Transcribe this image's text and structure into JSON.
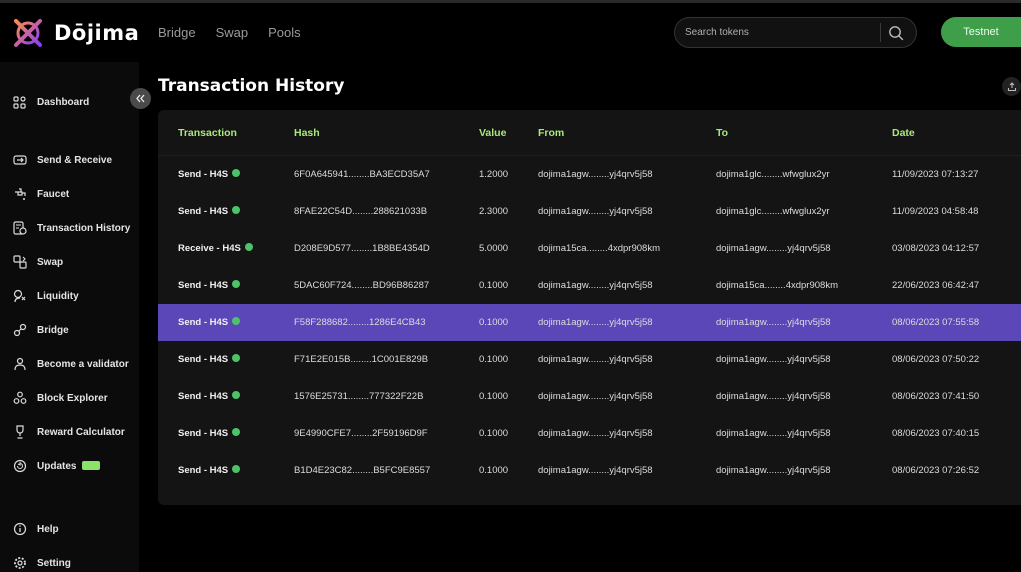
{
  "brand": {
    "name": "Dōjima"
  },
  "topnav": [
    {
      "label": "Bridge"
    },
    {
      "label": "Swap"
    },
    {
      "label": "Pools"
    }
  ],
  "search": {
    "placeholder": "Search tokens"
  },
  "network_button": {
    "label": "Testnet",
    "color": "#3f9e4a"
  },
  "sidebar": {
    "items": [
      {
        "label": "Dashboard",
        "icon": "dashboard-icon"
      },
      {
        "label": "Send & Receive",
        "icon": "send-receive-icon"
      },
      {
        "label": "Faucet",
        "icon": "faucet-icon"
      },
      {
        "label": "Transaction History",
        "icon": "history-icon"
      },
      {
        "label": "Swap",
        "icon": "swap-icon"
      },
      {
        "label": "Liquidity",
        "icon": "liquidity-icon"
      },
      {
        "label": "Bridge",
        "icon": "bridge-icon"
      },
      {
        "label": "Become a validator",
        "icon": "validator-icon"
      },
      {
        "label": "Block Explorer",
        "icon": "block-explorer-icon"
      },
      {
        "label": "Reward Calculator",
        "icon": "trophy-icon"
      },
      {
        "label": "Updates",
        "icon": "updates-icon",
        "badge": "new"
      },
      {
        "label": "Help",
        "icon": "help-icon"
      },
      {
        "label": "Setting",
        "icon": "gear-icon"
      }
    ]
  },
  "page": {
    "title": "Transaction History"
  },
  "table": {
    "columns": [
      "Transaction",
      "Hash",
      "Value",
      "From",
      "To",
      "Date"
    ],
    "rows": [
      {
        "transaction": "Send - H4S",
        "hash": "6F0A645941........BA3ECD35A7",
        "value": "1.2000",
        "from": "dojima1agw........yj4qrv5j58",
        "to": "dojima1glc........wfwglux2yr",
        "date": "11/09/2023 07:13:27"
      },
      {
        "transaction": "Send - H4S",
        "hash": "8FAE22C54D........288621033B",
        "value": "2.3000",
        "from": "dojima1agw........yj4qrv5j58",
        "to": "dojima1glc........wfwglux2yr",
        "date": "11/09/2023 04:58:48"
      },
      {
        "transaction": "Receive - H4S",
        "hash": "D208E9D577........1B8BE4354D",
        "value": "5.0000",
        "from": "dojima15ca........4xdpr908km",
        "to": "dojima1agw........yj4qrv5j58",
        "date": "03/08/2023 04:12:57"
      },
      {
        "transaction": "Send - H4S",
        "hash": "5DAC60F724........BD96B86287",
        "value": "0.1000",
        "from": "dojima1agw........yj4qrv5j58",
        "to": "dojima15ca........4xdpr908km",
        "date": "22/06/2023 06:42:47"
      },
      {
        "transaction": "Send - H4S",
        "hash": "F58F288682........1286E4CB43",
        "value": "0.1000",
        "from": "dojima1agw........yj4qrv5j58",
        "to": "dojima1agw........yj4qrv5j58",
        "date": "08/06/2023 07:55:58",
        "selected": true
      },
      {
        "transaction": "Send - H4S",
        "hash": "F71E2E015B........1C001E829B",
        "value": "0.1000",
        "from": "dojima1agw........yj4qrv5j58",
        "to": "dojima1agw........yj4qrv5j58",
        "date": "08/06/2023 07:50:22"
      },
      {
        "transaction": "Send - H4S",
        "hash": "1576E25731........777322F22B",
        "value": "0.1000",
        "from": "dojima1agw........yj4qrv5j58",
        "to": "dojima1agw........yj4qrv5j58",
        "date": "08/06/2023 07:41:50"
      },
      {
        "transaction": "Send - H4S",
        "hash": "9E4990CFE7........2F59196D9F",
        "value": "0.1000",
        "from": "dojima1agw........yj4qrv5j58",
        "to": "dojima1agw........yj4qrv5j58",
        "date": "08/06/2023 07:40:15"
      },
      {
        "transaction": "Send - H4S",
        "hash": "B1D4E23C82........B5FC9E8557",
        "value": "0.1000",
        "from": "dojima1agw........yj4qrv5j58",
        "to": "dojima1agw........yj4qrv5j58",
        "date": "08/06/2023 07:26:52"
      }
    ]
  },
  "colors": {
    "accent_green": "#a9e879",
    "selected_row": "#5b47b8",
    "status_ok": "#4cc36b"
  }
}
